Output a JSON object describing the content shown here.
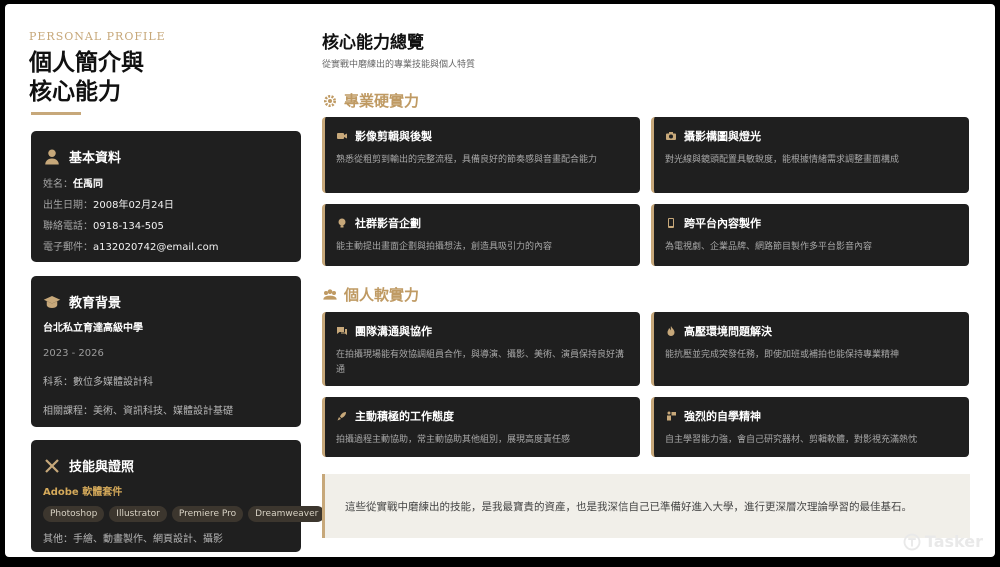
{
  "left": {
    "eyebrow": "PERSONAL PROFILE",
    "title_line1": "個人簡介與",
    "title_line2": "核心能力",
    "basic": {
      "heading": "基本資料",
      "name_label": "姓名：",
      "name_value": "任禹同",
      "dob_label": "出生日期：",
      "dob_value": "2008年02月24日",
      "phone_label": "聯絡電話：",
      "phone_value": "0918-134-505",
      "email_label": "電子郵件：",
      "email_value": "a132020742@email.com"
    },
    "education": {
      "heading": "教育背景",
      "school": "台北私立育達高級中學",
      "period": "2023 - 2026",
      "dept": "科系：數位多媒體設計科",
      "courses": "相關課程：美術、資訊科技、媒體設計基礎"
    },
    "skills": {
      "heading": "技能與證照",
      "adobe": "Adobe 軟體套件",
      "pills": [
        "Photoshop",
        "Illustrator",
        "Premiere Pro",
        "Dreamweaver"
      ],
      "others": "其他：手繪、動畫製作、網頁設計、攝影"
    }
  },
  "right": {
    "title": "核心能力總覽",
    "subtitle": "從實戰中磨練出的專業技能與個人特質",
    "hard_heading": "專業硬實力",
    "hard": [
      {
        "title": "影像剪輯與後製",
        "desc": "熟悉從粗剪到輸出的完整流程，具備良好的節奏感與音畫配合能力",
        "icon": "video-icon"
      },
      {
        "title": "攝影構圖與燈光",
        "desc": "對光線與鏡頭配置具敏銳度，能根據情緒需求調整畫面構成",
        "icon": "camera-icon"
      },
      {
        "title": "社群影音企劃",
        "desc": "能主動提出畫面企劃與拍攝想法，創造具吸引力的內容",
        "icon": "lightbulb-icon"
      },
      {
        "title": "跨平台內容製作",
        "desc": "為電視劇、企業品牌、網路節目製作多平台影音內容",
        "icon": "phone-icon"
      }
    ],
    "soft_heading": "個人軟實力",
    "soft": [
      {
        "title": "團隊溝通與協作",
        "desc": "在拍攝現場能有效協調組員合作，與導演、攝影、美術、演員保持良好溝通",
        "icon": "chat-icon"
      },
      {
        "title": "高壓環境問題解決",
        "desc": "能抗壓並完成突發任務，即使加班或補拍也能保持專業精神",
        "icon": "fire-icon"
      },
      {
        "title": "主動積極的工作態度",
        "desc": "拍攝過程主動協助，常主動協助其他組別，展現高度責任感",
        "icon": "rocket-icon"
      },
      {
        "title": "強烈的自學精神",
        "desc": "自主學習能力強，會自己研究器材、剪輯軟體，對影視充滿熱忱",
        "icon": "learner-icon"
      }
    ],
    "quote": "這些從實戰中磨練出的技能，是我最寶貴的資產，也是我深信自己已準備好進入大學，進行更深層次理論學習的最佳基石。"
  },
  "watermark": "Tasker",
  "colors": {
    "accent": "#c7a87a",
    "card": "#1f1f1f"
  }
}
